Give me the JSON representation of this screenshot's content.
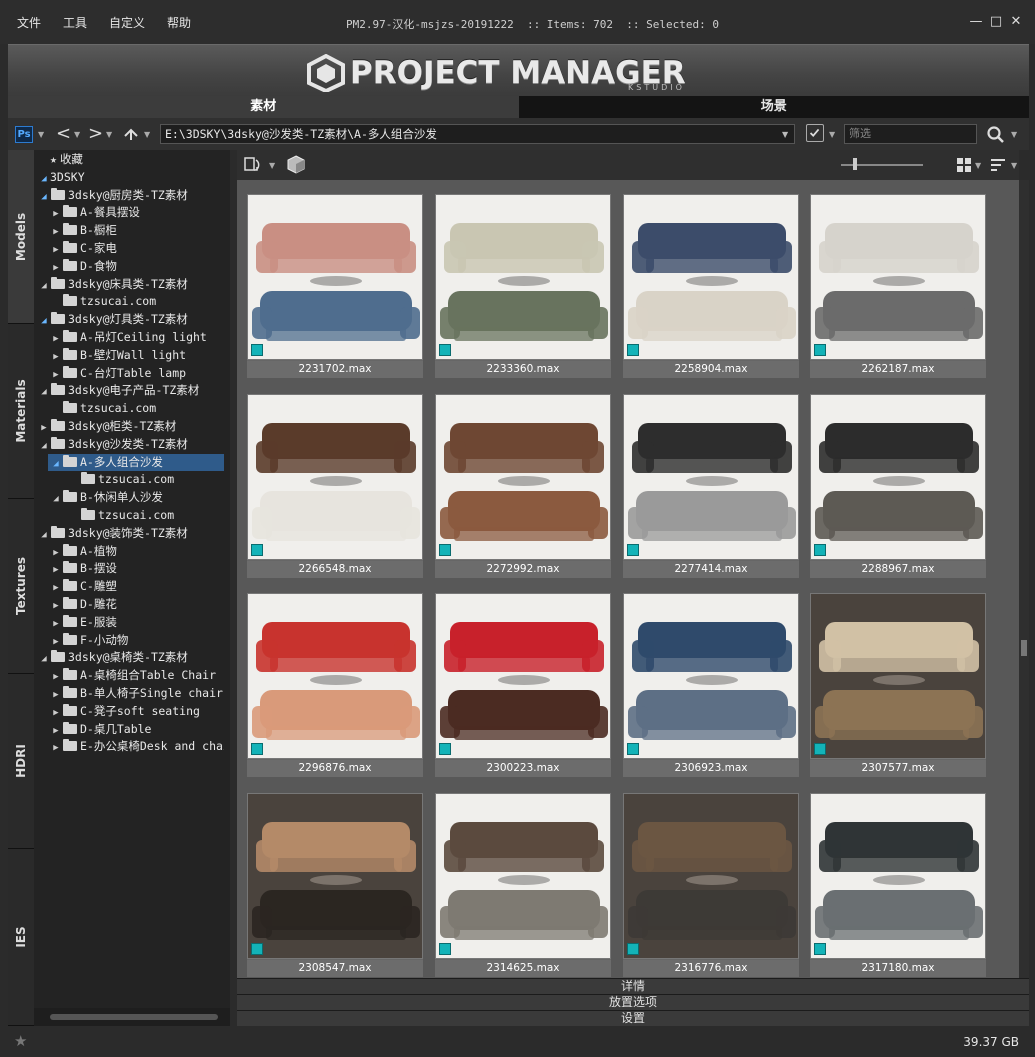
{
  "menu": [
    "文件",
    "工具",
    "自定义",
    "帮助"
  ],
  "title": "PM2.97-汉化-msjzs-20191222  :: Items: 702  :: Selected: 0",
  "window_buttons": {
    "minimize": "—",
    "maximize": "□",
    "close": "✕"
  },
  "logo": {
    "text": "PROJECT MANAGER",
    "sub": "KSTUDIO"
  },
  "tabs": [
    {
      "label": "素材",
      "active": true
    },
    {
      "label": "场景",
      "active": false
    }
  ],
  "toolbar": {
    "ps_label": "Ps",
    "path": "E:\\3DSKY\\3dsky@沙发类-TZ素材\\A-多人组合沙发",
    "filter_placeholder": "筛选"
  },
  "side_tabs": [
    "Models",
    "Materials",
    "Textures",
    "HDRI",
    "IES"
  ],
  "tree": [
    {
      "label": "收藏",
      "depth": 0,
      "arrow": "",
      "icon": "star"
    },
    {
      "label": "3DSKY",
      "depth": 0,
      "arrow": "open",
      "icon": "none"
    },
    {
      "label": "3dsky@厨房类-TZ素材",
      "depth": 1,
      "arrow": "open",
      "icon": "folder"
    },
    {
      "label": "A-餐具摆设",
      "depth": 2,
      "arrow": "closed",
      "icon": "folder"
    },
    {
      "label": "B-橱柜",
      "depth": 2,
      "arrow": "closed",
      "icon": "folder"
    },
    {
      "label": "C-家电",
      "depth": 2,
      "arrow": "closed",
      "icon": "folder"
    },
    {
      "label": "D-食物",
      "depth": 2,
      "arrow": "closed",
      "icon": "folder"
    },
    {
      "label": "3dsky@床具类-TZ素材",
      "depth": 1,
      "arrow": "open-dim",
      "icon": "folder"
    },
    {
      "label": "tzsucai.com",
      "depth": 2,
      "arrow": "",
      "icon": "folder"
    },
    {
      "label": "3dsky@灯具类-TZ素材",
      "depth": 1,
      "arrow": "open",
      "icon": "folder"
    },
    {
      "label": "A-吊灯Ceiling light",
      "depth": 2,
      "arrow": "closed",
      "icon": "folder"
    },
    {
      "label": "B-壁灯Wall light",
      "depth": 2,
      "arrow": "closed",
      "icon": "folder"
    },
    {
      "label": "C-台灯Table lamp",
      "depth": 2,
      "arrow": "closed",
      "icon": "folder"
    },
    {
      "label": "3dsky@电子产品-TZ素材",
      "depth": 1,
      "arrow": "open-dim",
      "icon": "folder"
    },
    {
      "label": "tzsucai.com",
      "depth": 2,
      "arrow": "",
      "icon": "folder"
    },
    {
      "label": "3dsky@柜类-TZ素材",
      "depth": 1,
      "arrow": "closed",
      "icon": "folder"
    },
    {
      "label": "3dsky@沙发类-TZ素材",
      "depth": 1,
      "arrow": "open-dim",
      "icon": "folder"
    },
    {
      "label": "A-多人组合沙发",
      "depth": 2,
      "arrow": "open",
      "icon": "folder",
      "selected": true
    },
    {
      "label": "tzsucai.com",
      "depth": 3,
      "arrow": "",
      "icon": "folder"
    },
    {
      "label": "B-休闲单人沙发",
      "depth": 2,
      "arrow": "open-dim",
      "icon": "folder"
    },
    {
      "label": "tzsucai.com",
      "depth": 3,
      "arrow": "",
      "icon": "folder"
    },
    {
      "label": "3dsky@装饰类-TZ素材",
      "depth": 1,
      "arrow": "open-dim",
      "icon": "folder"
    },
    {
      "label": "A-植物",
      "depth": 2,
      "arrow": "closed",
      "icon": "folder"
    },
    {
      "label": "B-摆设",
      "depth": 2,
      "arrow": "closed",
      "icon": "folder"
    },
    {
      "label": "C-雕塑",
      "depth": 2,
      "arrow": "closed",
      "icon": "folder"
    },
    {
      "label": "D-雕花",
      "depth": 2,
      "arrow": "closed",
      "icon": "folder"
    },
    {
      "label": "E-服装",
      "depth": 2,
      "arrow": "closed",
      "icon": "folder"
    },
    {
      "label": "F-小动物",
      "depth": 2,
      "arrow": "closed",
      "icon": "folder"
    },
    {
      "label": "3dsky@桌椅类-TZ素材",
      "depth": 1,
      "arrow": "open-dim",
      "icon": "folder"
    },
    {
      "label": "A-桌椅组合Table Chair",
      "depth": 2,
      "arrow": "closed",
      "icon": "folder"
    },
    {
      "label": "B-单人椅子Single chair",
      "depth": 2,
      "arrow": "closed",
      "icon": "folder"
    },
    {
      "label": "C-凳子soft seating",
      "depth": 2,
      "arrow": "closed",
      "icon": "folder"
    },
    {
      "label": "D-桌几Table",
      "depth": 2,
      "arrow": "closed",
      "icon": "folder"
    },
    {
      "label": "E-办公桌椅Desk and chair",
      "depth": 2,
      "arrow": "closed",
      "icon": "folder"
    }
  ],
  "items": [
    {
      "name": "2231702.max",
      "style": "white"
    },
    {
      "name": "2233360.max",
      "style": "white"
    },
    {
      "name": "2258904.max",
      "style": "white"
    },
    {
      "name": "2262187.max",
      "style": "white"
    },
    {
      "name": "2266548.max",
      "style": "white"
    },
    {
      "name": "2272992.max",
      "style": "white"
    },
    {
      "name": "2277414.max",
      "style": "white"
    },
    {
      "name": "2288967.max",
      "style": "white"
    },
    {
      "name": "2296876.max",
      "style": "white"
    },
    {
      "name": "2300223.max",
      "style": "white"
    },
    {
      "name": "2306923.max",
      "style": "white"
    },
    {
      "name": "2307577.max",
      "style": "room"
    },
    {
      "name": "2308547.max",
      "style": "room"
    },
    {
      "name": "2314625.max",
      "style": "white"
    },
    {
      "name": "2316776.max",
      "style": "room"
    },
    {
      "name": "2317180.max",
      "style": "white"
    }
  ],
  "panels": [
    "详情",
    "放置选项",
    "设置"
  ],
  "status": {
    "disk_free": "39.37 GB"
  },
  "colors": {
    "selected": "#2f5b8a",
    "accent_blue": "#6ab7ff",
    "max_badge": "#13b3b8"
  }
}
